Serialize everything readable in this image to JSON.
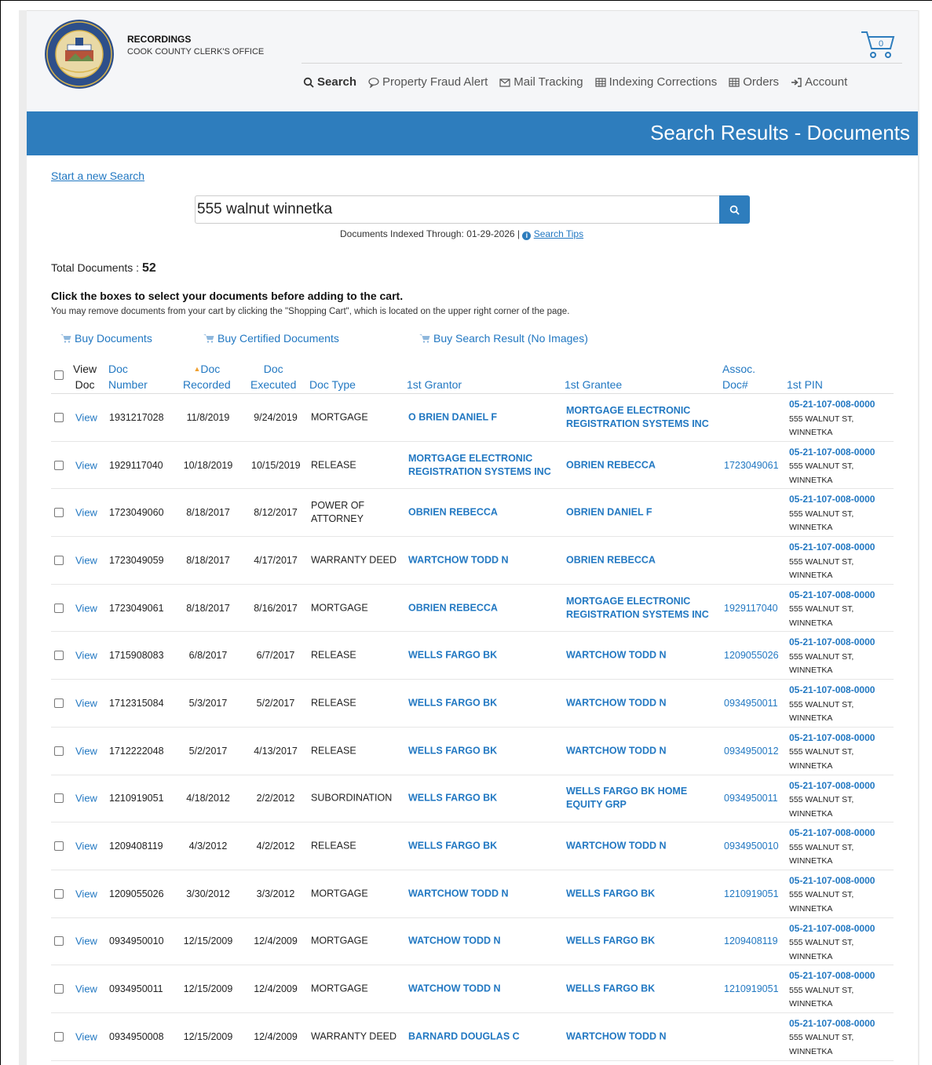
{
  "brand": {
    "title": "RECORDINGS",
    "subtitle": "COOK COUNTY CLERK'S OFFICE",
    "seal_text": "SEAL OF COOK COUNTY ILLINOIS",
    "seal_date": "JANUARY 15 1831"
  },
  "cart": {
    "count": "0"
  },
  "nav": {
    "search": "Search",
    "fraud": "Property Fraud Alert",
    "mail": "Mail Tracking",
    "indexing": "Indexing Corrections",
    "orders": "Orders",
    "account": "Account"
  },
  "banner": {
    "title": "Search Results - Documents"
  },
  "search": {
    "new_search": "Start a new Search",
    "query": "555 walnut winnetka",
    "indexed_label": "Documents Indexed Through: 01-29-2026 |",
    "tips": "Search Tips"
  },
  "results": {
    "total_label": "Total Documents :",
    "total": "52",
    "instruction_bold": "Click the boxes to select your documents before adding to the cart.",
    "instruction": "You may remove documents from your cart by clicking the \"Shopping Cart\", which is located on the upper right corner of the page."
  },
  "buy": {
    "documents": "Buy Documents",
    "certified": "Buy Certified Documents",
    "result": "Buy Search Result (No Images)"
  },
  "columns": {
    "view1": "View",
    "view2": "Doc",
    "num1": "Doc",
    "num2": "Number",
    "rec1": "Doc",
    "rec2": "Recorded",
    "exe1": "Doc",
    "exe2": "Executed",
    "type": "Doc Type",
    "grantor": "1st Grantor",
    "grantee": "1st Grantee",
    "assoc1": "Assoc.",
    "assoc2": "Doc#",
    "pin": "1st PIN"
  },
  "view_label": "View",
  "rows": [
    {
      "num": "1931217028",
      "rec": "11/8/2019",
      "exe": "9/24/2019",
      "type": [
        "MORTGAGE"
      ],
      "grantor": [
        "O BRIEN DANIEL F"
      ],
      "grantee": [
        "MORTGAGE ELECTRONIC",
        "REGISTRATION SYSTEMS INC"
      ],
      "assoc": "",
      "pin": "05-21-107-008-0000",
      "addr1": "555 WALNUT ST,",
      "addr2": "WINNETKA"
    },
    {
      "num": "1929117040",
      "rec": "10/18/2019",
      "exe": "10/15/2019",
      "type": [
        "RELEASE"
      ],
      "grantor": [
        "MORTGAGE ELECTRONIC",
        "REGISTRATION SYSTEMS INC"
      ],
      "grantee": [
        "OBRIEN REBECCA"
      ],
      "assoc": "1723049061",
      "pin": "05-21-107-008-0000",
      "addr1": "555 WALNUT ST,",
      "addr2": "WINNETKA"
    },
    {
      "num": "1723049060",
      "rec": "8/18/2017",
      "exe": "8/12/2017",
      "type": [
        "POWER OF",
        "ATTORNEY"
      ],
      "grantor": [
        "OBRIEN REBECCA"
      ],
      "grantee": [
        "OBRIEN DANIEL F"
      ],
      "assoc": "",
      "pin": "05-21-107-008-0000",
      "addr1": "555 WALNUT ST,",
      "addr2": "WINNETKA"
    },
    {
      "num": "1723049059",
      "rec": "8/18/2017",
      "exe": "4/17/2017",
      "type": [
        "WARRANTY DEED"
      ],
      "grantor": [
        "WARTCHOW TODD N"
      ],
      "grantee": [
        "OBRIEN REBECCA"
      ],
      "assoc": "",
      "pin": "05-21-107-008-0000",
      "addr1": "555 WALNUT ST,",
      "addr2": "WINNETKA"
    },
    {
      "num": "1723049061",
      "rec": "8/18/2017",
      "exe": "8/16/2017",
      "type": [
        "MORTGAGE"
      ],
      "grantor": [
        "OBRIEN REBECCA"
      ],
      "grantee": [
        "MORTGAGE ELECTRONIC",
        "REGISTRATION SYSTEMS INC"
      ],
      "assoc": "1929117040",
      "pin": "05-21-107-008-0000",
      "addr1": "555 WALNUT ST,",
      "addr2": "WINNETKA"
    },
    {
      "num": "1715908083",
      "rec": "6/8/2017",
      "exe": "6/7/2017",
      "type": [
        "RELEASE"
      ],
      "grantor": [
        "WELLS FARGO BK"
      ],
      "grantee": [
        "WARTCHOW TODD N"
      ],
      "assoc": "1209055026",
      "pin": "05-21-107-008-0000",
      "addr1": "555 WALNUT ST,",
      "addr2": "WINNETKA"
    },
    {
      "num": "1712315084",
      "rec": "5/3/2017",
      "exe": "5/2/2017",
      "type": [
        "RELEASE"
      ],
      "grantor": [
        "WELLS FARGO BK"
      ],
      "grantee": [
        "WARTCHOW TODD N"
      ],
      "assoc": "0934950011",
      "pin": "05-21-107-008-0000",
      "addr1": "555 WALNUT ST,",
      "addr2": "WINNETKA"
    },
    {
      "num": "1712222048",
      "rec": "5/2/2017",
      "exe": "4/13/2017",
      "type": [
        "RELEASE"
      ],
      "grantor": [
        "WELLS FARGO BK"
      ],
      "grantee": [
        "WARTCHOW TODD N"
      ],
      "assoc": "0934950012",
      "pin": "05-21-107-008-0000",
      "addr1": "555 WALNUT ST,",
      "addr2": "WINNETKA"
    },
    {
      "num": "1210919051",
      "rec": "4/18/2012",
      "exe": "2/2/2012",
      "type": [
        "SUBORDINATION"
      ],
      "grantor": [
        "WELLS FARGO BK"
      ],
      "grantee": [
        "WELLS FARGO BK HOME",
        "EQUITY GRP"
      ],
      "assoc": "0934950011",
      "pin": "05-21-107-008-0000",
      "addr1": "555 WALNUT ST,",
      "addr2": "WINNETKA"
    },
    {
      "num": "1209408119",
      "rec": "4/3/2012",
      "exe": "4/2/2012",
      "type": [
        "RELEASE"
      ],
      "grantor": [
        "WELLS FARGO BK"
      ],
      "grantee": [
        "WARTCHOW TODD N"
      ],
      "assoc": "0934950010",
      "pin": "05-21-107-008-0000",
      "addr1": "555 WALNUT ST,",
      "addr2": "WINNETKA"
    },
    {
      "num": "1209055026",
      "rec": "3/30/2012",
      "exe": "3/3/2012",
      "type": [
        "MORTGAGE"
      ],
      "grantor": [
        "WARTCHOW TODD N"
      ],
      "grantee": [
        "WELLS FARGO BK"
      ],
      "assoc": "1210919051",
      "pin": "05-21-107-008-0000",
      "addr1": "555 WALNUT ST,",
      "addr2": "WINNETKA"
    },
    {
      "num": "0934950010",
      "rec": "12/15/2009",
      "exe": "12/4/2009",
      "type": [
        "MORTGAGE"
      ],
      "grantor": [
        "WATCHOW TODD N"
      ],
      "grantee": [
        "WELLS FARGO BK"
      ],
      "assoc": "1209408119",
      "pin": "05-21-107-008-0000",
      "addr1": "555 WALNUT ST,",
      "addr2": "WINNETKA"
    },
    {
      "num": "0934950011",
      "rec": "12/15/2009",
      "exe": "12/4/2009",
      "type": [
        "MORTGAGE"
      ],
      "grantor": [
        "WATCHOW TODD N"
      ],
      "grantee": [
        "WELLS FARGO BK"
      ],
      "assoc": "1210919051",
      "pin": "05-21-107-008-0000",
      "addr1": "555 WALNUT ST,",
      "addr2": "WINNETKA"
    },
    {
      "num": "0934950008",
      "rec": "12/15/2009",
      "exe": "12/4/2009",
      "type": [
        "WARRANTY DEED"
      ],
      "grantor": [
        "BARNARD DOUGLAS C"
      ],
      "grantee": [
        "WARTCHOW TODD N"
      ],
      "assoc": "",
      "pin": "05-21-107-008-0000",
      "addr1": "555 WALNUT ST,",
      "addr2": "WINNETKA"
    }
  ]
}
